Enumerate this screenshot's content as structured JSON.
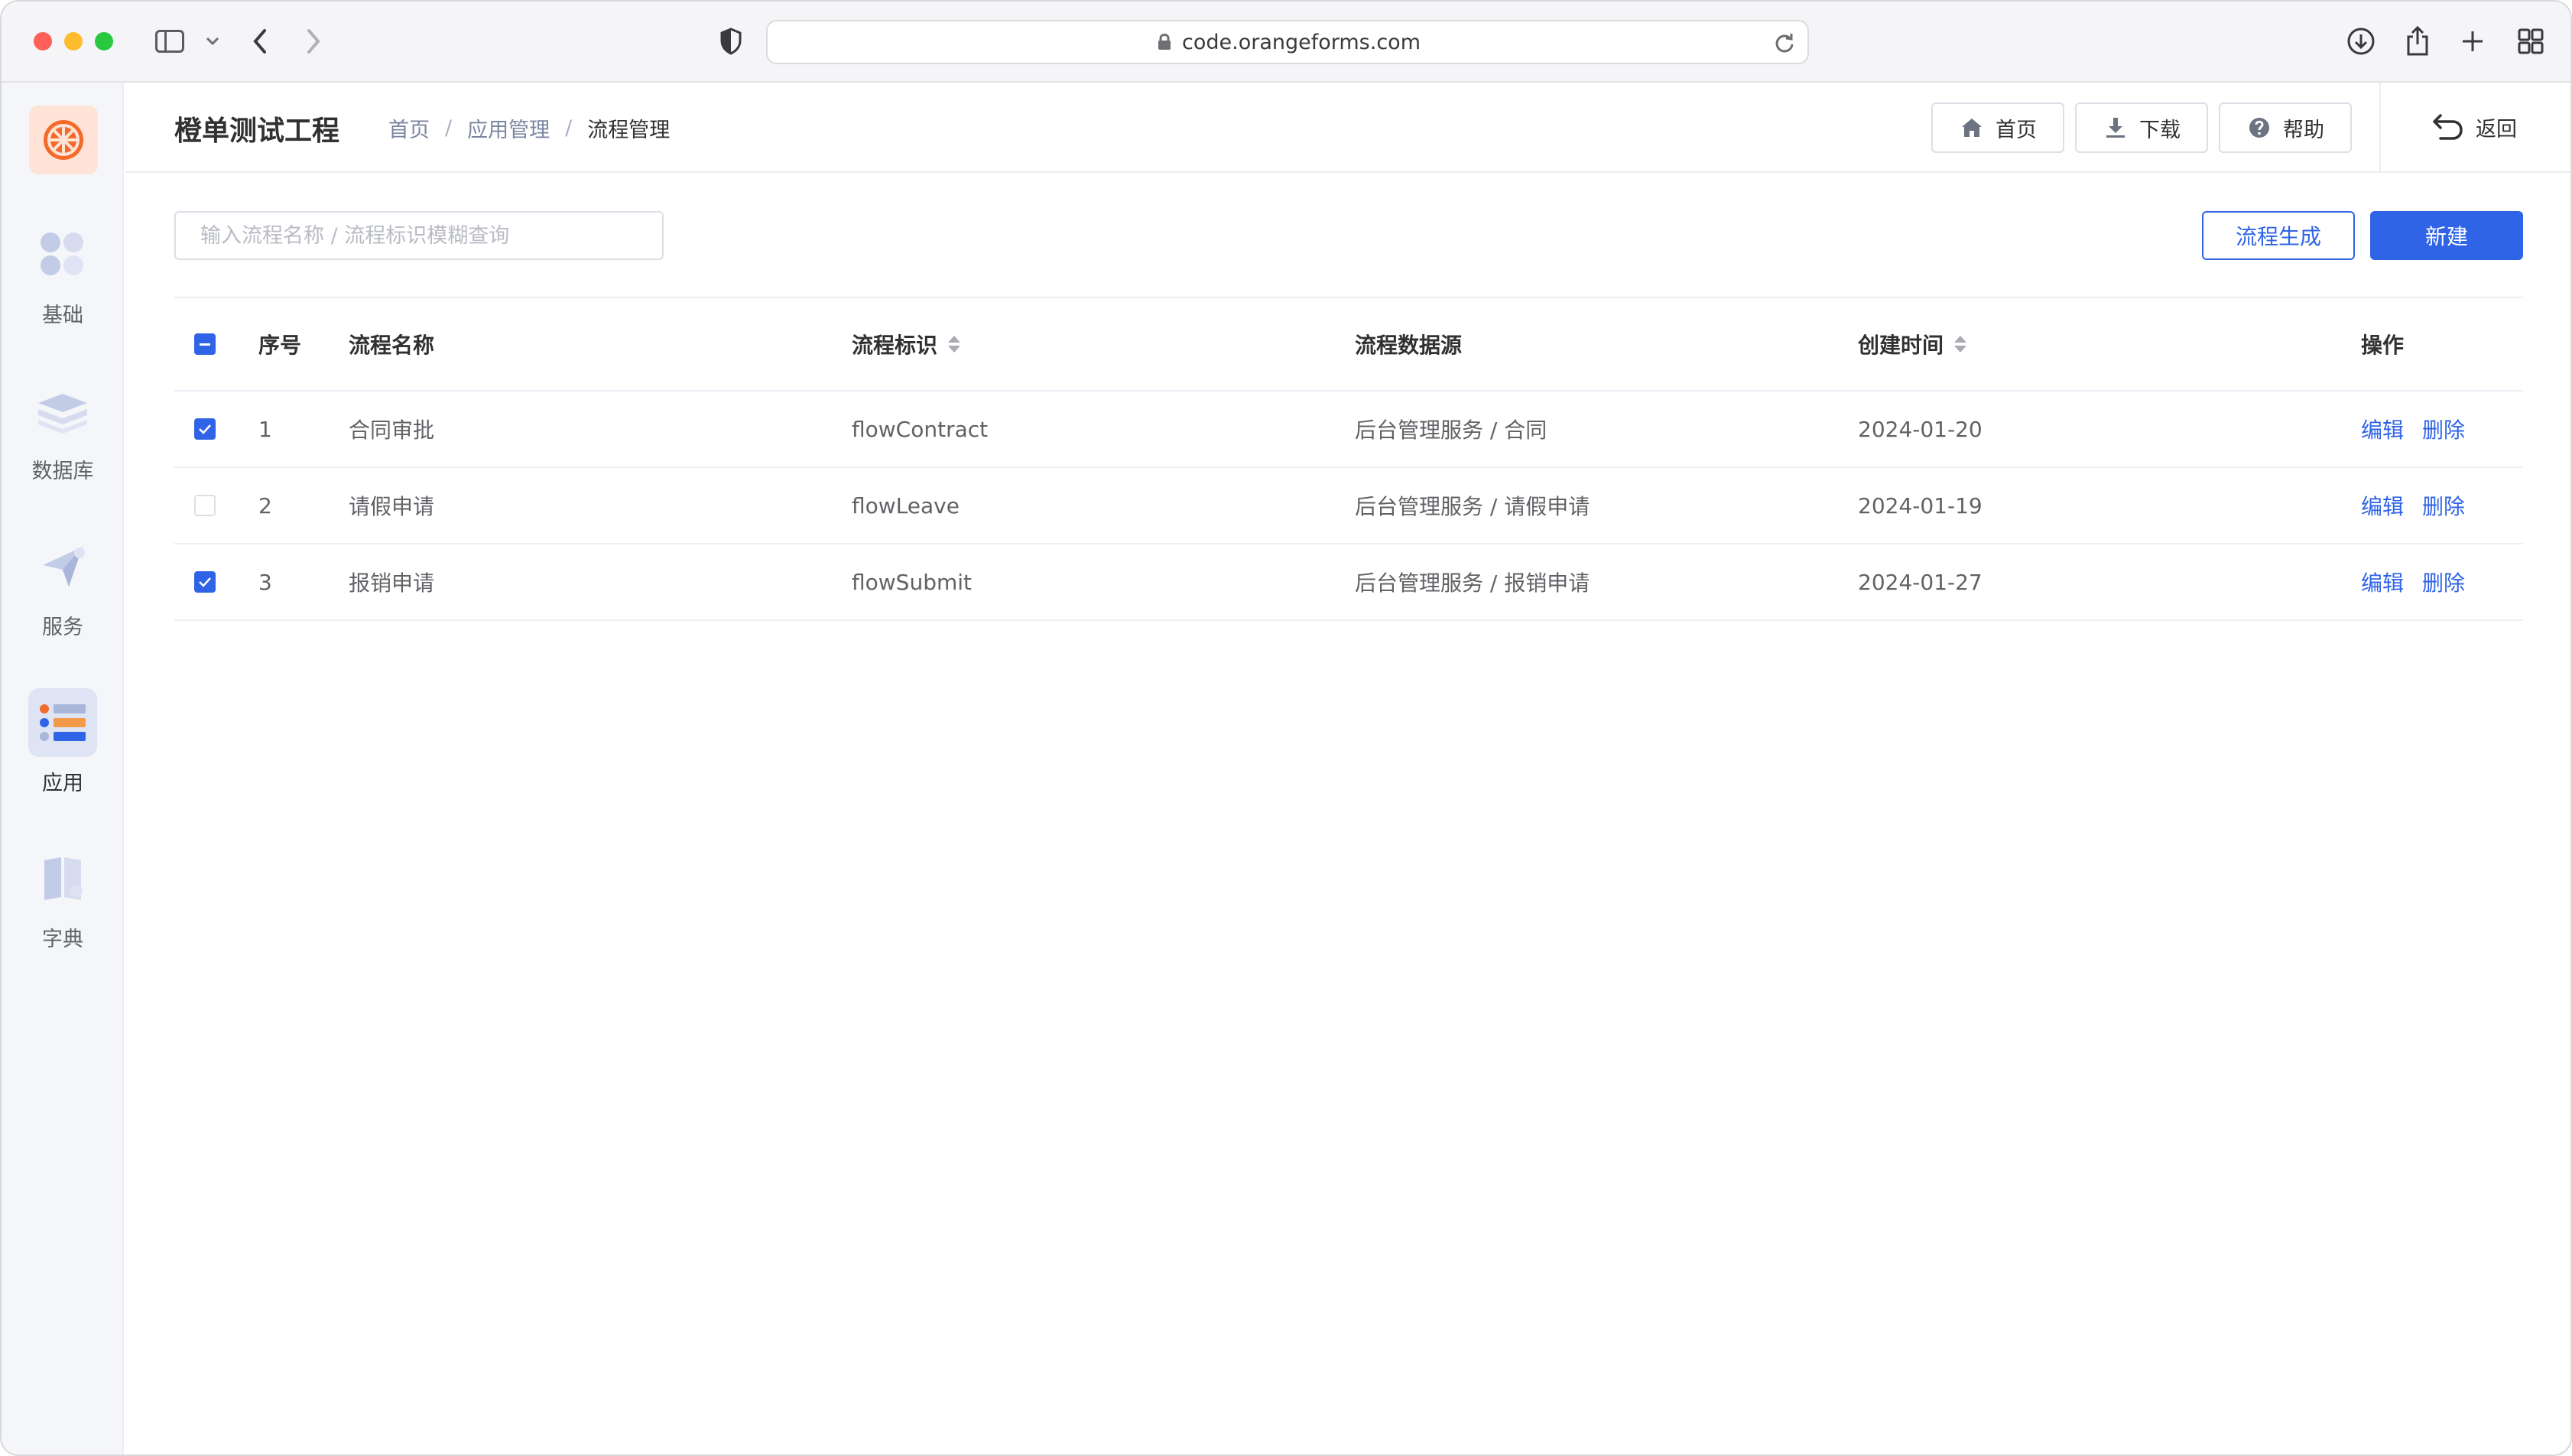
{
  "browser": {
    "url": "code.orangeforms.com"
  },
  "sidebar": {
    "items": [
      {
        "label": "基础",
        "icon": "grid-icon"
      },
      {
        "label": "数据库",
        "icon": "layers-icon"
      },
      {
        "label": "服务",
        "icon": "send-icon"
      },
      {
        "label": "应用",
        "icon": "app-list-icon",
        "active": true
      },
      {
        "label": "字典",
        "icon": "book-icon"
      }
    ]
  },
  "header": {
    "title": "橙单测试工程",
    "breadcrumb": [
      "首页",
      "应用管理",
      "流程管理"
    ],
    "separator": "/",
    "buttons": {
      "home": "首页",
      "download": "下载",
      "help": "帮助"
    },
    "back": "返回"
  },
  "toolbar": {
    "search_placeholder": "输入流程名称 / 流程标识模糊查询",
    "generate_label": "流程生成",
    "new_label": "新建"
  },
  "table": {
    "columns": [
      "序号",
      "流程名称",
      "流程标识",
      "流程数据源",
      "创建时间",
      "操作"
    ],
    "rows": [
      {
        "index": "1",
        "name": "合同审批",
        "key": "flowContract",
        "source": "后台管理服务 / 合同",
        "created": "2024-01-20",
        "checked": true
      },
      {
        "index": "2",
        "name": "请假申请",
        "key": "flowLeave",
        "source": "后台管理服务 / 请假申请",
        "created": "2024-01-19",
        "checked": false
      },
      {
        "index": "3",
        "name": "报销申请",
        "key": "flowSubmit",
        "source": "后台管理服务 / 报销申请",
        "created": "2024-01-27",
        "checked": true
      }
    ],
    "ops": {
      "edit": "编辑",
      "delete": "删除"
    }
  },
  "colors": {
    "primary": "#2f64e6",
    "sidebar_bg": "#f5f6fa",
    "brand_orange": "#f26b2b"
  }
}
